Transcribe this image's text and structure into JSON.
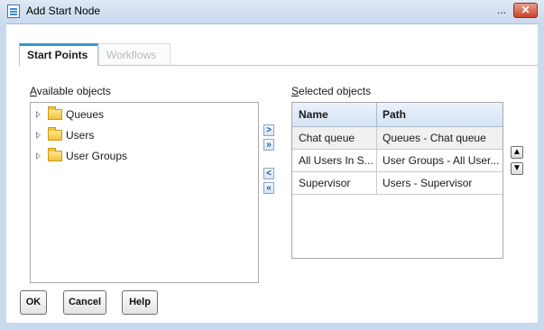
{
  "window": {
    "title": "Add Start Node",
    "ellipsis": "...",
    "close_label": "✕"
  },
  "tabs": [
    {
      "label": "Start Points",
      "active": true
    },
    {
      "label": "Workflows",
      "active": false
    }
  ],
  "available": {
    "label_first": "A",
    "label_rest": "vailable objects",
    "items": [
      {
        "label": "Queues",
        "icon": "folder-icon"
      },
      {
        "label": "Users",
        "icon": "folder-icon"
      },
      {
        "label": "User Groups",
        "icon": "folder-icon"
      }
    ]
  },
  "move_buttons": {
    "add": ">",
    "add_all": "»",
    "remove": "<",
    "remove_all": "«"
  },
  "selected": {
    "label_first": "S",
    "label_rest": "elected objects",
    "columns": [
      "Name",
      "Path"
    ],
    "rows": [
      {
        "name": "Chat queue",
        "path": "Queues - Chat queue"
      },
      {
        "name": "All Users In S...",
        "path": "User Groups - All User..."
      },
      {
        "name": "Supervisor",
        "path": "Users - Supervisor"
      }
    ]
  },
  "order_buttons": {
    "up": "▲",
    "down": "▼"
  },
  "footer": {
    "ok": "OK",
    "cancel": "Cancel",
    "help": "Help"
  },
  "colors": {
    "accent": "#2f9ad8",
    "titlebar": "#c9d9ee",
    "close": "#c8432a"
  }
}
